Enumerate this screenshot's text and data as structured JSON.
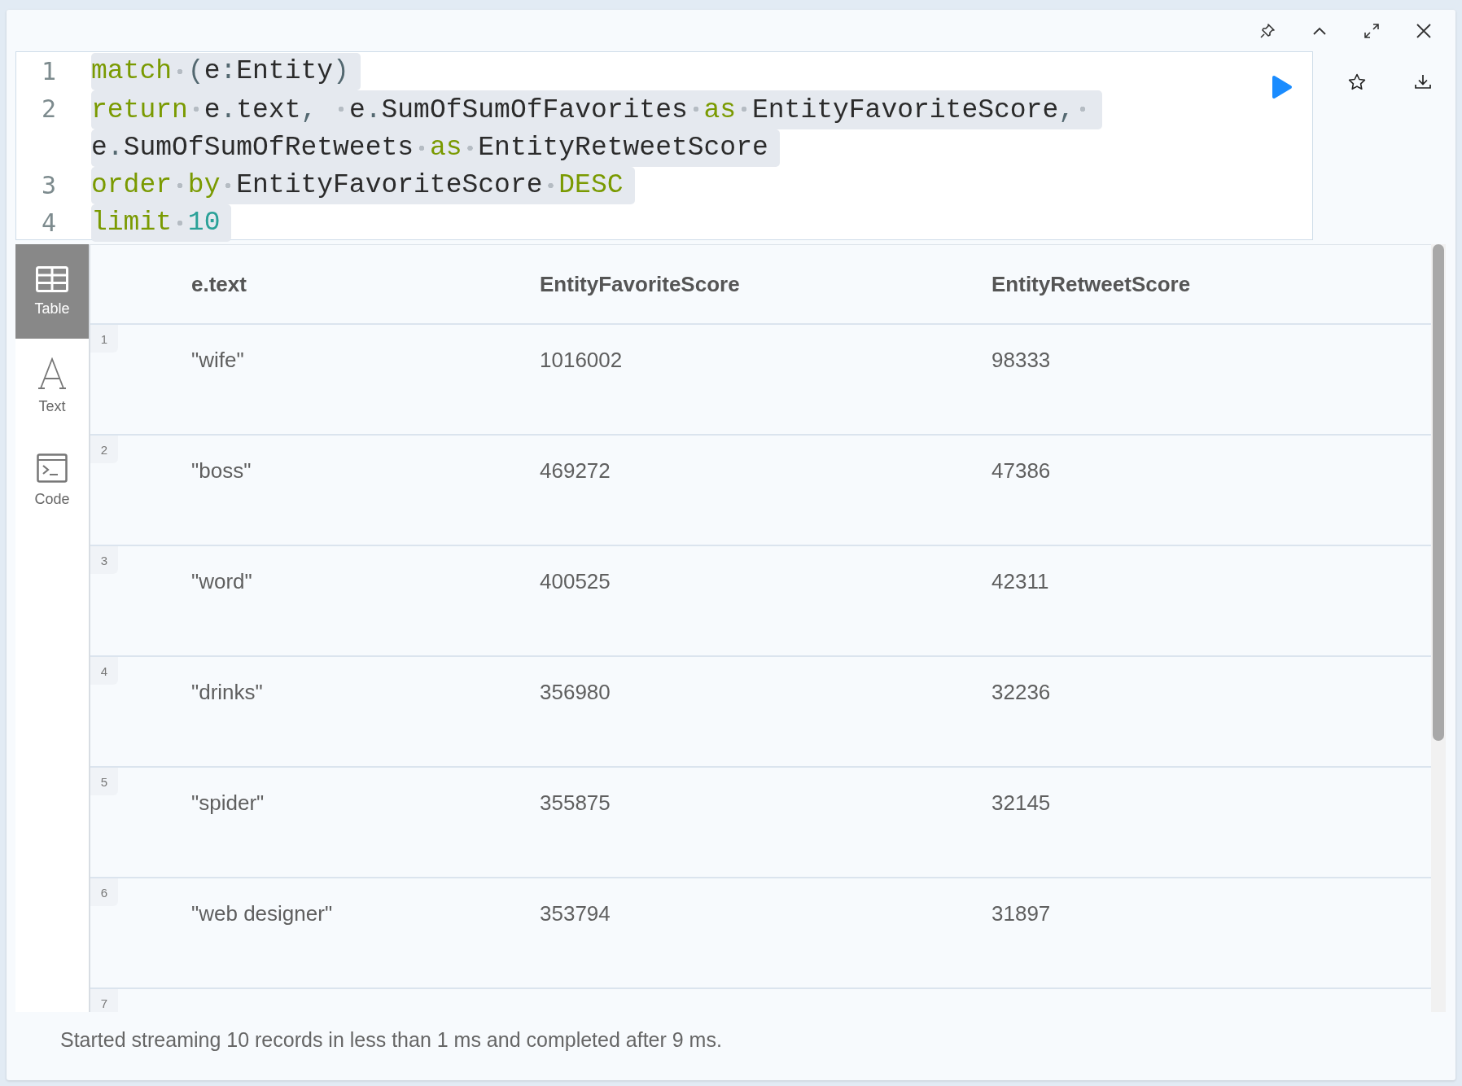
{
  "editor": {
    "lines": [
      {
        "number": "1",
        "segments": [
          {
            "tokens": [
              {
                "kind": "keyword",
                "text": "match"
              },
              {
                "kind": "space"
              },
              {
                "kind": "punct",
                "text": "("
              },
              {
                "kind": "plain",
                "text": "e"
              },
              {
                "kind": "punct",
                "text": ":"
              },
              {
                "kind": "plain",
                "text": "Entity"
              },
              {
                "kind": "punct",
                "text": ")"
              }
            ]
          }
        ]
      },
      {
        "number": "2",
        "segments": [
          {
            "tokens": [
              {
                "kind": "keyword",
                "text": "return"
              },
              {
                "kind": "space"
              },
              {
                "kind": "plain",
                "text": "e"
              },
              {
                "kind": "punct",
                "text": "."
              },
              {
                "kind": "plain",
                "text": "text"
              },
              {
                "kind": "punct",
                "text": ","
              },
              {
                "kind": "blank"
              },
              {
                "kind": "space"
              },
              {
                "kind": "plain",
                "text": "e"
              },
              {
                "kind": "punct",
                "text": "."
              },
              {
                "kind": "plain",
                "text": "SumOfSumOfFavorites"
              },
              {
                "kind": "space"
              },
              {
                "kind": "keyword",
                "text": "as"
              },
              {
                "kind": "space"
              },
              {
                "kind": "plain",
                "text": "EntityFavoriteScore"
              },
              {
                "kind": "punct",
                "text": ","
              },
              {
                "kind": "space"
              }
            ]
          },
          {
            "tokens": [
              {
                "kind": "plain",
                "text": "e"
              },
              {
                "kind": "punct",
                "text": "."
              },
              {
                "kind": "plain",
                "text": "SumOfSumOfRetweets"
              },
              {
                "kind": "space"
              },
              {
                "kind": "keyword",
                "text": "as"
              },
              {
                "kind": "space"
              },
              {
                "kind": "plain",
                "text": "EntityRetweetScore"
              }
            ]
          }
        ]
      },
      {
        "number": "3",
        "segments": [
          {
            "tokens": [
              {
                "kind": "keyword",
                "text": "order"
              },
              {
                "kind": "space"
              },
              {
                "kind": "keyword",
                "text": "by"
              },
              {
                "kind": "space"
              },
              {
                "kind": "plain",
                "text": "EntityFavoriteScore"
              },
              {
                "kind": "space"
              },
              {
                "kind": "keyword",
                "text": "DESC"
              }
            ]
          }
        ]
      },
      {
        "number": "4",
        "segments": [
          {
            "tokens": [
              {
                "kind": "keyword",
                "text": "limit"
              },
              {
                "kind": "space"
              },
              {
                "kind": "number",
                "text": "10"
              }
            ]
          }
        ]
      }
    ]
  },
  "views": [
    {
      "label": "Table",
      "kind": "table",
      "selected": true
    },
    {
      "label": "Text",
      "kind": "text",
      "selected": false
    },
    {
      "label": "Code",
      "kind": "code",
      "selected": false
    }
  ],
  "table": {
    "columns": [
      "e.text",
      "EntityFavoriteScore",
      "EntityRetweetScore"
    ],
    "rows": [
      {
        "number": "1",
        "cells": [
          "\"wife\"",
          "1016002",
          "98333"
        ]
      },
      {
        "number": "2",
        "cells": [
          "\"boss\"",
          "469272",
          "47386"
        ]
      },
      {
        "number": "3",
        "cells": [
          "\"word\"",
          "400525",
          "42311"
        ]
      },
      {
        "number": "4",
        "cells": [
          "\"drinks\"",
          "356980",
          "32236"
        ]
      },
      {
        "number": "5",
        "cells": [
          "\"spider\"",
          "355875",
          "32145"
        ]
      },
      {
        "number": "6",
        "cells": [
          "\"web designer\"",
          "353794",
          "31897"
        ]
      },
      {
        "number": "7"
      }
    ]
  },
  "status_bar": "Started streaming 10 records in less than 1 ms and completed after 9 ms."
}
